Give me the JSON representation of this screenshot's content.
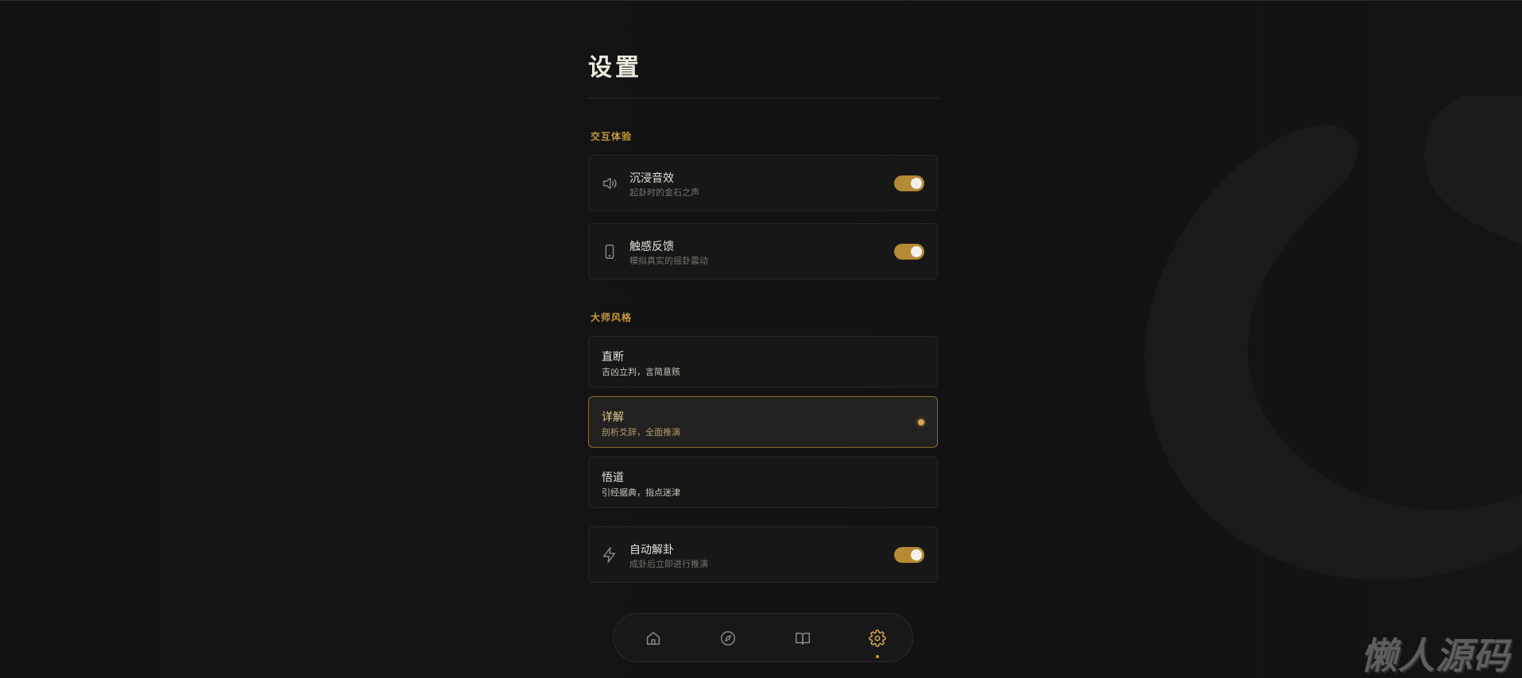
{
  "page": {
    "title": "设置"
  },
  "sections": {
    "interaction": {
      "label": "交互体验",
      "items": [
        {
          "title": "沉浸音效",
          "subtitle": "起卦时的金石之声",
          "icon": "speaker-icon",
          "enabled": true
        },
        {
          "title": "触感反馈",
          "subtitle": "模拟真实的摇卦震动",
          "icon": "phone-icon",
          "enabled": true
        }
      ]
    },
    "master_style": {
      "label": "大师风格",
      "options": [
        {
          "title": "直断",
          "subtitle": "吉凶立判，言简意赅",
          "selected": false
        },
        {
          "title": "详解",
          "subtitle": "剖析爻辞，全面推演",
          "selected": true
        },
        {
          "title": "悟道",
          "subtitle": "引经据典，指点迷津",
          "selected": false
        }
      ]
    },
    "auto": {
      "title": "自动解卦",
      "subtitle": "成卦后立即进行推演",
      "icon": "lightning-icon",
      "enabled": true
    }
  },
  "bottom_nav": {
    "items": [
      {
        "icon": "home-icon",
        "active": false
      },
      {
        "icon": "compass-icon",
        "active": false
      },
      {
        "icon": "book-icon",
        "active": false
      },
      {
        "icon": "gear-icon",
        "active": true
      }
    ]
  },
  "watermark": {
    "text": "懒人源码"
  },
  "colors": {
    "accent": "#c99a3a",
    "toggle_on": "#b48a34",
    "background": "#121212",
    "card": "#171717"
  }
}
